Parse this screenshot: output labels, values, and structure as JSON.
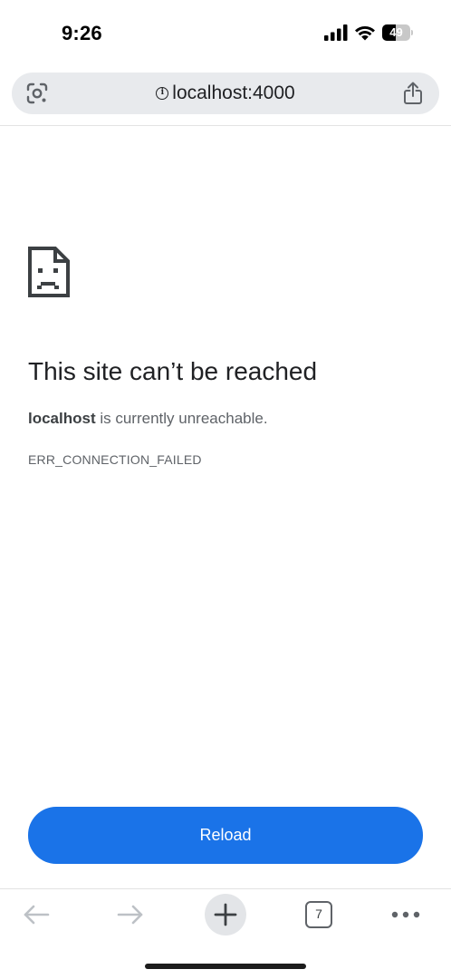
{
  "status_bar": {
    "time": "9:26",
    "battery_level": "49",
    "icons": [
      "cellular-signal-icon",
      "wifi-icon",
      "battery-icon"
    ]
  },
  "address_bar": {
    "url": "localhost:4000",
    "left_icon": "google-lens-icon",
    "security_icon": "info-icon",
    "right_icon": "share-icon"
  },
  "error": {
    "icon": "sad-page-icon",
    "title": "This site can’t be reached",
    "host": "localhost",
    "message": " is currently unreachable.",
    "code": "ERR_CONNECTION_FAILED"
  },
  "reload_button": {
    "label": "Reload"
  },
  "toolbar": {
    "back_icon": "back-arrow-icon",
    "forward_icon": "forward-arrow-icon",
    "new_tab_icon": "plus-icon",
    "tab_count": "7",
    "menu_icon": "more-horizontal-icon"
  },
  "colors": {
    "accent": "#1a73e8",
    "address_bar_bg": "#e8eaed",
    "text_primary": "#202124",
    "text_secondary": "#5f6368"
  }
}
